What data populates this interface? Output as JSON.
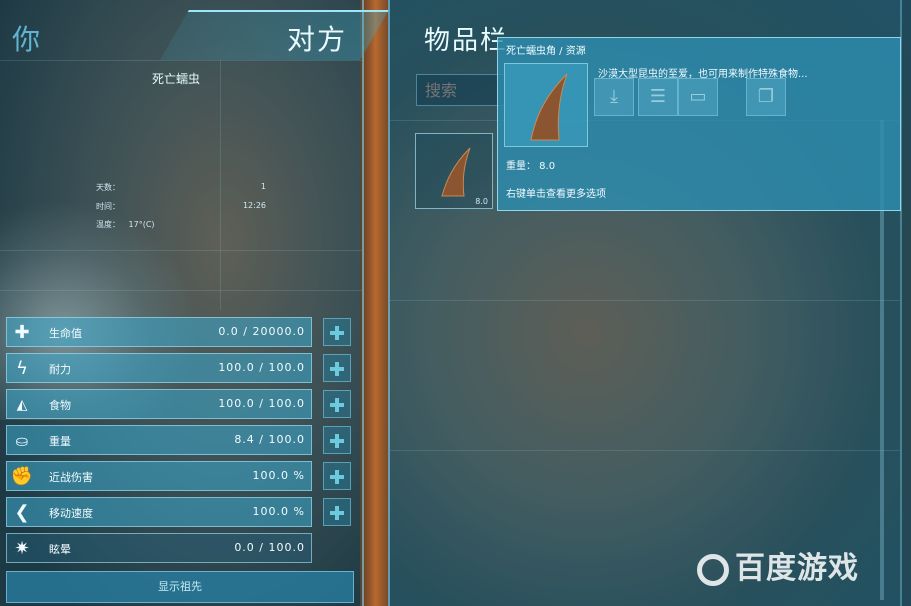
{
  "left": {
    "title_you": "你",
    "title_opponent": "对方",
    "character_name": "死亡蠕虫",
    "info": [
      {
        "label": "天数：",
        "value": "1"
      },
      {
        "label": "时间：",
        "value": "12:26"
      },
      {
        "label": "温度：",
        "value": "17°(C)"
      }
    ],
    "stats": [
      {
        "icon": "plus-icon",
        "label": "生命值",
        "value": "0.0  /  20000.0",
        "glyph": "✚"
      },
      {
        "icon": "lightning-icon",
        "label": "耐力",
        "value": "100.0  /  100.0",
        "glyph": "ϟ"
      },
      {
        "icon": "food-icon",
        "label": "食物",
        "value": "100.0  /  100.0",
        "glyph": "🍗"
      },
      {
        "icon": "weight-icon",
        "label": "重量",
        "value": "8.4  /  100.0",
        "glyph": "⚖"
      },
      {
        "icon": "fist-icon",
        "label": "近战伤害",
        "value": "100.0  %",
        "glyph": "✊"
      },
      {
        "icon": "speed-icon",
        "label": "移动速度",
        "value": "100.0  %",
        "glyph": "❮"
      },
      {
        "icon": "stun-icon",
        "label": "眩晕",
        "value": "0.0  /  100.0",
        "glyph": "✷"
      }
    ],
    "ancestors_button": "显示祖先"
  },
  "inventory": {
    "title": "物品栏",
    "search_placeholder": "搜索",
    "slot_weight": "8.0",
    "tooltip": {
      "header": "死亡蠕虫角  /  资源",
      "description": "沙漠大型昆虫的至爱，也可用来制作特殊食物...",
      "weight": "重量： 8.0",
      "more": "右键单击查看更多选项"
    }
  },
  "watermark": "百度游戏",
  "colors": {
    "accent": "#4fb4d6",
    "panel": "#2d8caf",
    "text": "#dff6ff",
    "horn": "#8a5530"
  }
}
